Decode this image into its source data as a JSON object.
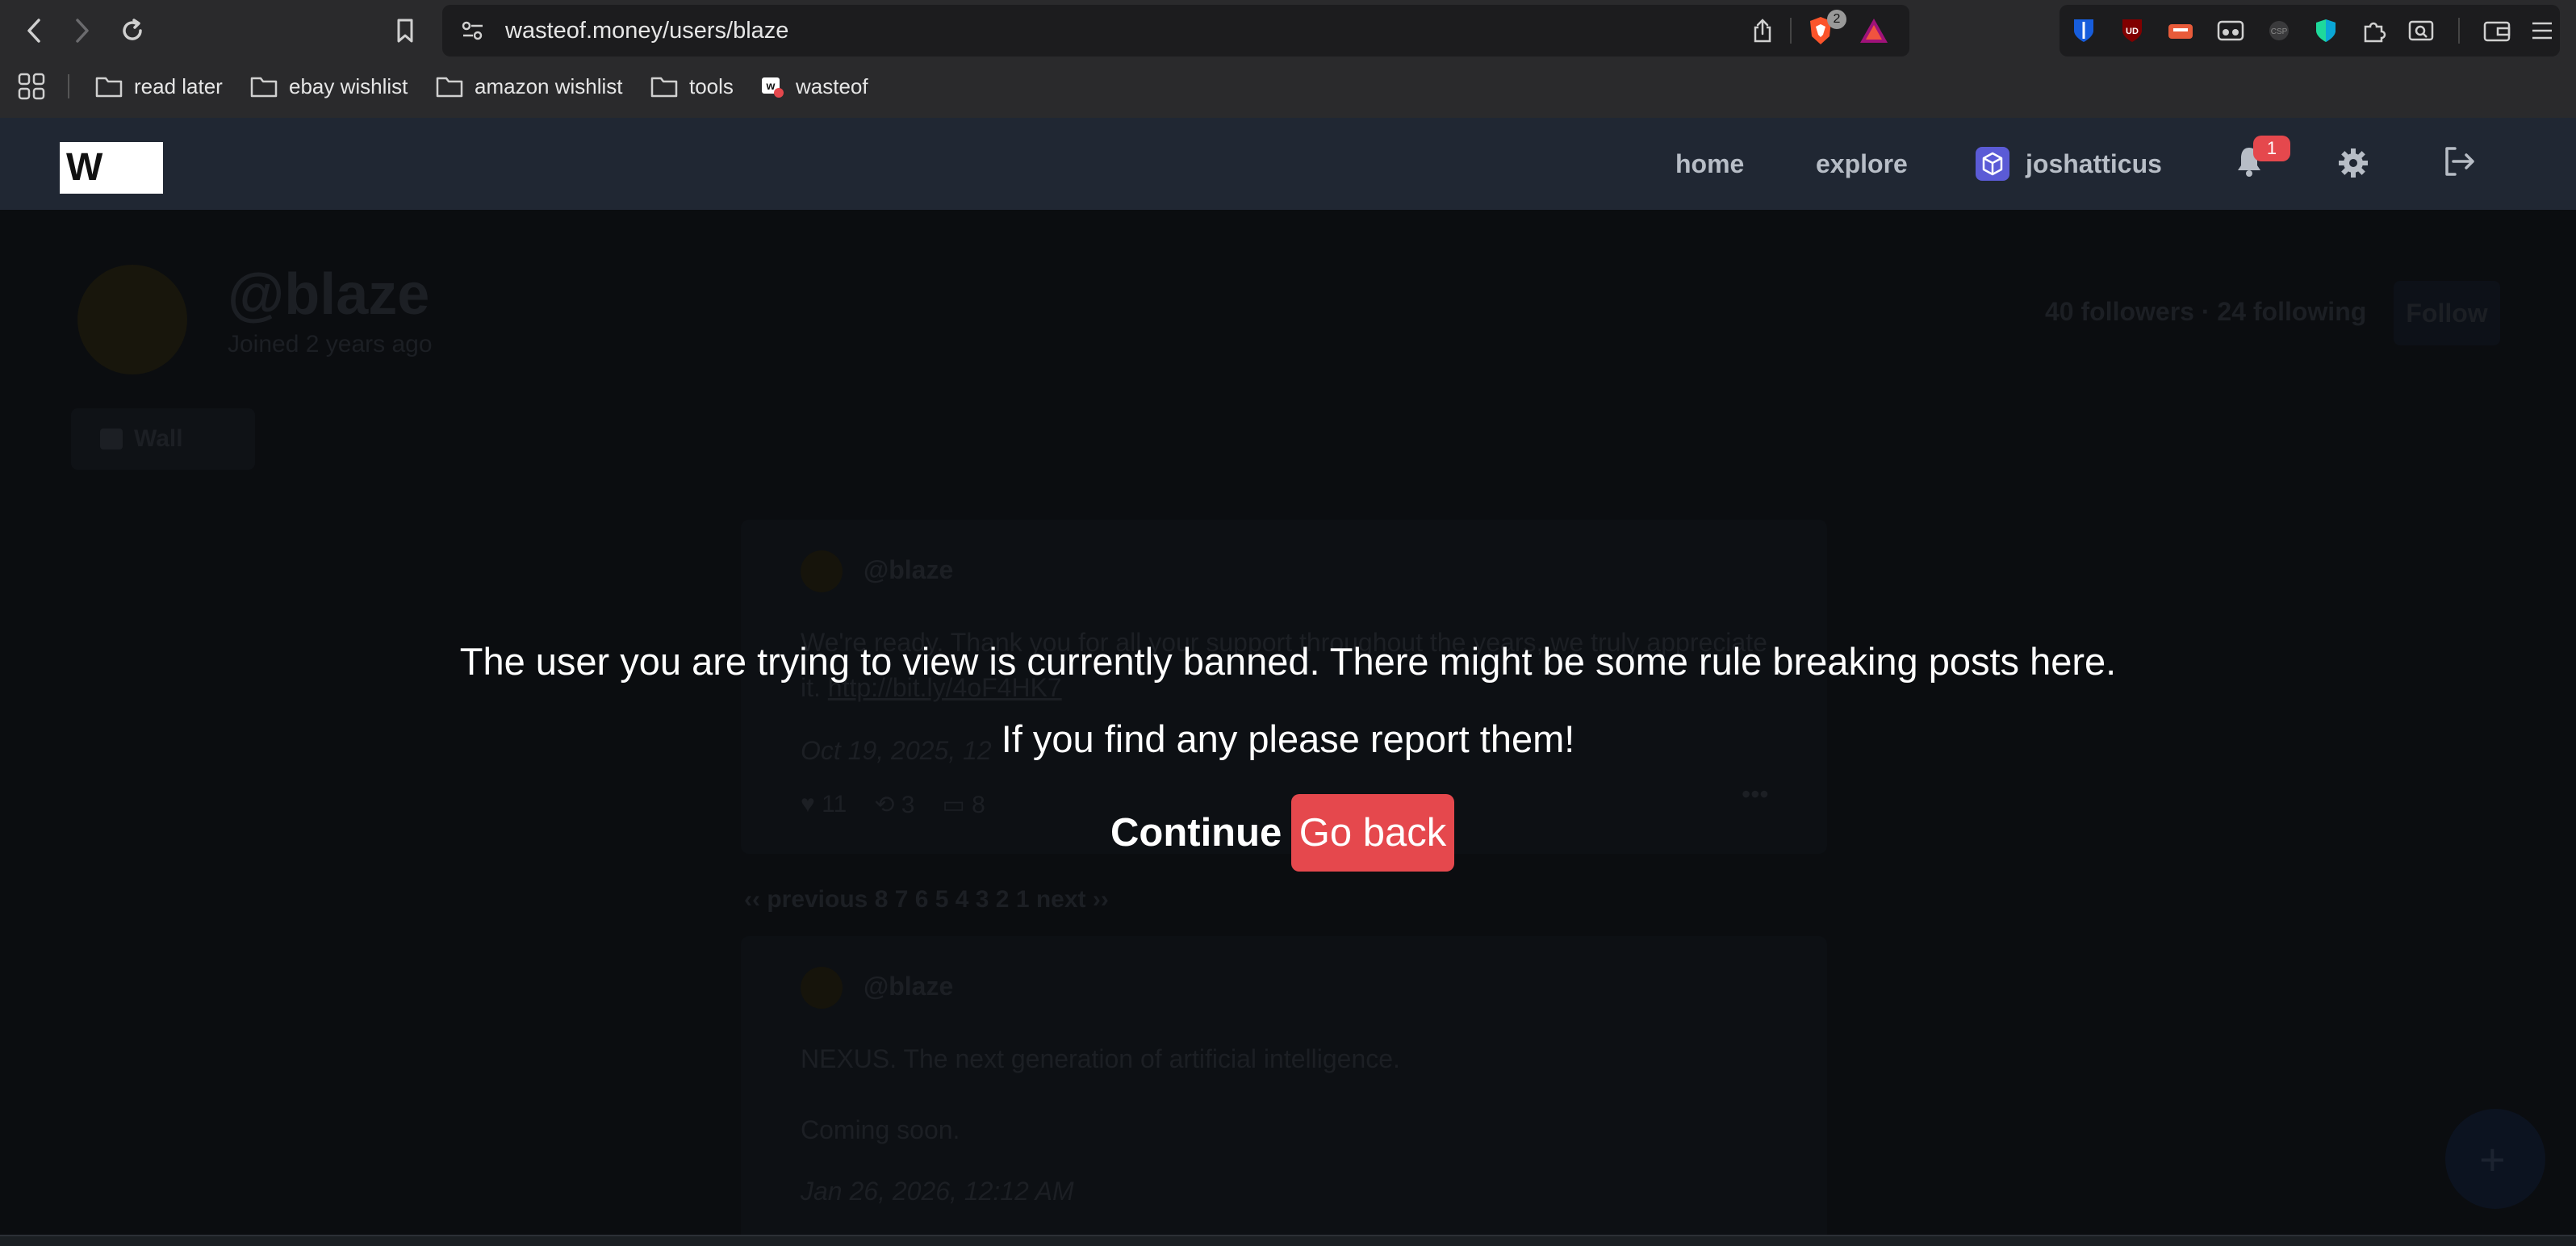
{
  "browser": {
    "url": "wasteof.money/users/blaze",
    "brave_badge": "2"
  },
  "bookmarks": [
    {
      "label": "read later",
      "icon": "folder-icon"
    },
    {
      "label": "ebay wishlist",
      "icon": "folder-icon"
    },
    {
      "label": "amazon wishlist",
      "icon": "folder-icon"
    },
    {
      "label": "tools",
      "icon": "folder-icon"
    },
    {
      "label": "wasteof",
      "icon": "wasteof-favicon"
    }
  ],
  "site_nav": {
    "logo": "W",
    "home": "home",
    "explore": "explore",
    "username": "joshatticus",
    "notification_count": "1"
  },
  "profile": {
    "handle": "@blaze",
    "joined": "Joined 2 years ago",
    "stats": "40 followers · 24 following",
    "follow_label": "Follow",
    "wall_label": "Wall"
  },
  "posts": [
    {
      "author": "@blaze",
      "text": "We're ready. Thank you for all your support throughout the years, we truly appreciate it.",
      "link": "http://bit.ly/4oF4HK7",
      "date": "Oct 19, 2025, 12",
      "likes": "11",
      "reposts": "3",
      "comments": "8"
    },
    {
      "author": "@blaze",
      "text": "NEXUS. The next generation of artificial intelligence.",
      "text2": "Coming soon.",
      "date": "Jan 26, 2026, 12:12 AM"
    }
  ],
  "pagination": "‹‹ previous 8 7 6 5 4 3 2 1 next ››",
  "modal": {
    "line1": "The user you are trying to view is currently banned. There might be some rule breaking posts here.",
    "line2": "If you find any please report them!",
    "continue_label": "Continue",
    "goback_label": "Go back"
  },
  "colors": {
    "nav_bg": "#202733",
    "accent_red": "#e5484d",
    "toolbar_bg": "#2a2a2c"
  }
}
